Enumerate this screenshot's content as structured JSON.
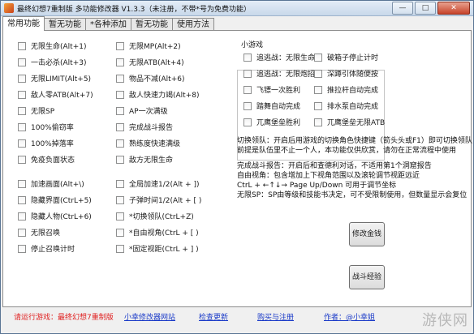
{
  "window": {
    "title": "最终幻想7重制版 多功能修改器  V1.3.3（未注册，不带*号为免费功能）",
    "minimize": "—",
    "maximize": "□",
    "close": "✕"
  },
  "tabs": [
    "常用功能",
    "暂无功能",
    "*各种添加",
    "暂无功能",
    "使用方法"
  ],
  "col1": [
    "无限生命(Alt+1)",
    "一击必杀(Alt+3)",
    "无限LIMIT(Alt+5)",
    "敌人零ATB(Alt+7)",
    "无限SP",
    "100%偷窃率",
    "100%掉落率",
    "免疫负面状态",
    "加速画面(Alt+\\)",
    "隐藏界面(CtrL+5)",
    "隐藏人物(CtrL+6)",
    "无限召唤",
    "停止召唤计时"
  ],
  "col2": [
    "无限MP(Alt+2)",
    "无限ATB(Alt+4)",
    "物品不减(Alt+6)",
    "敌人快速力竭(Alt+8)",
    "AP一次满级",
    "完成战斗报告",
    "熟练度快速满级",
    "敌方无限生命",
    "全局加速1/2(Alt + ])",
    "子弹时间1/2(Alt + [ )",
    "*切换领队(CtrL+Z)",
    "*自由视角(CtrL + [ )",
    "*固定视距(CtrL + ] )"
  ],
  "minigame": {
    "label": "小游戏",
    "items": [
      "追逃战：无限生命",
      "破箱子停止计时",
      "追逃战：无限炮招",
      "深蹲引体随便按",
      "飞镖一次胜利",
      "推拉杆自动完成",
      "踏舞自动完成",
      "排水泵自动完成",
      "兀鹰堡垒胜利",
      "兀鹰堡垒无限ATB"
    ]
  },
  "info": {
    "switch_lines": [
      "切换领队：开启后用游戏的切换角色快捷键（箭头头或F1）即可切换领队",
      "前提是队伍里不止一个人，本功能仅供欣赏，请勿在正常流程中使用"
    ],
    "report_lines": [
      "完成战斗报告：开启后和查德利对话，不适用第1个洞窟报告",
      "自由视角：包含增加上下视角范围以及滚轮调节视距远近",
      "CtrL + ←↑↓→  Page Up/Down 可用于调节坐标",
      "无限SP：SP由等级和技能书决定，可不受限制使用，但数量显示会复位"
    ]
  },
  "buttons": {
    "gil": "修改金钱",
    "exp": "战斗经验"
  },
  "footer": {
    "game_prompt": "请运行游戏：最终幻想7重制版",
    "site": "小幸修改器网站",
    "update": "检查更新",
    "purchase": "购买与注册",
    "author": "作者：@小幸姐"
  },
  "watermark": "游侠网",
  "colors": {
    "prompt": "#e02020",
    "link": "#1a3ac8",
    "title_gradient": "#c8d8ea"
  }
}
